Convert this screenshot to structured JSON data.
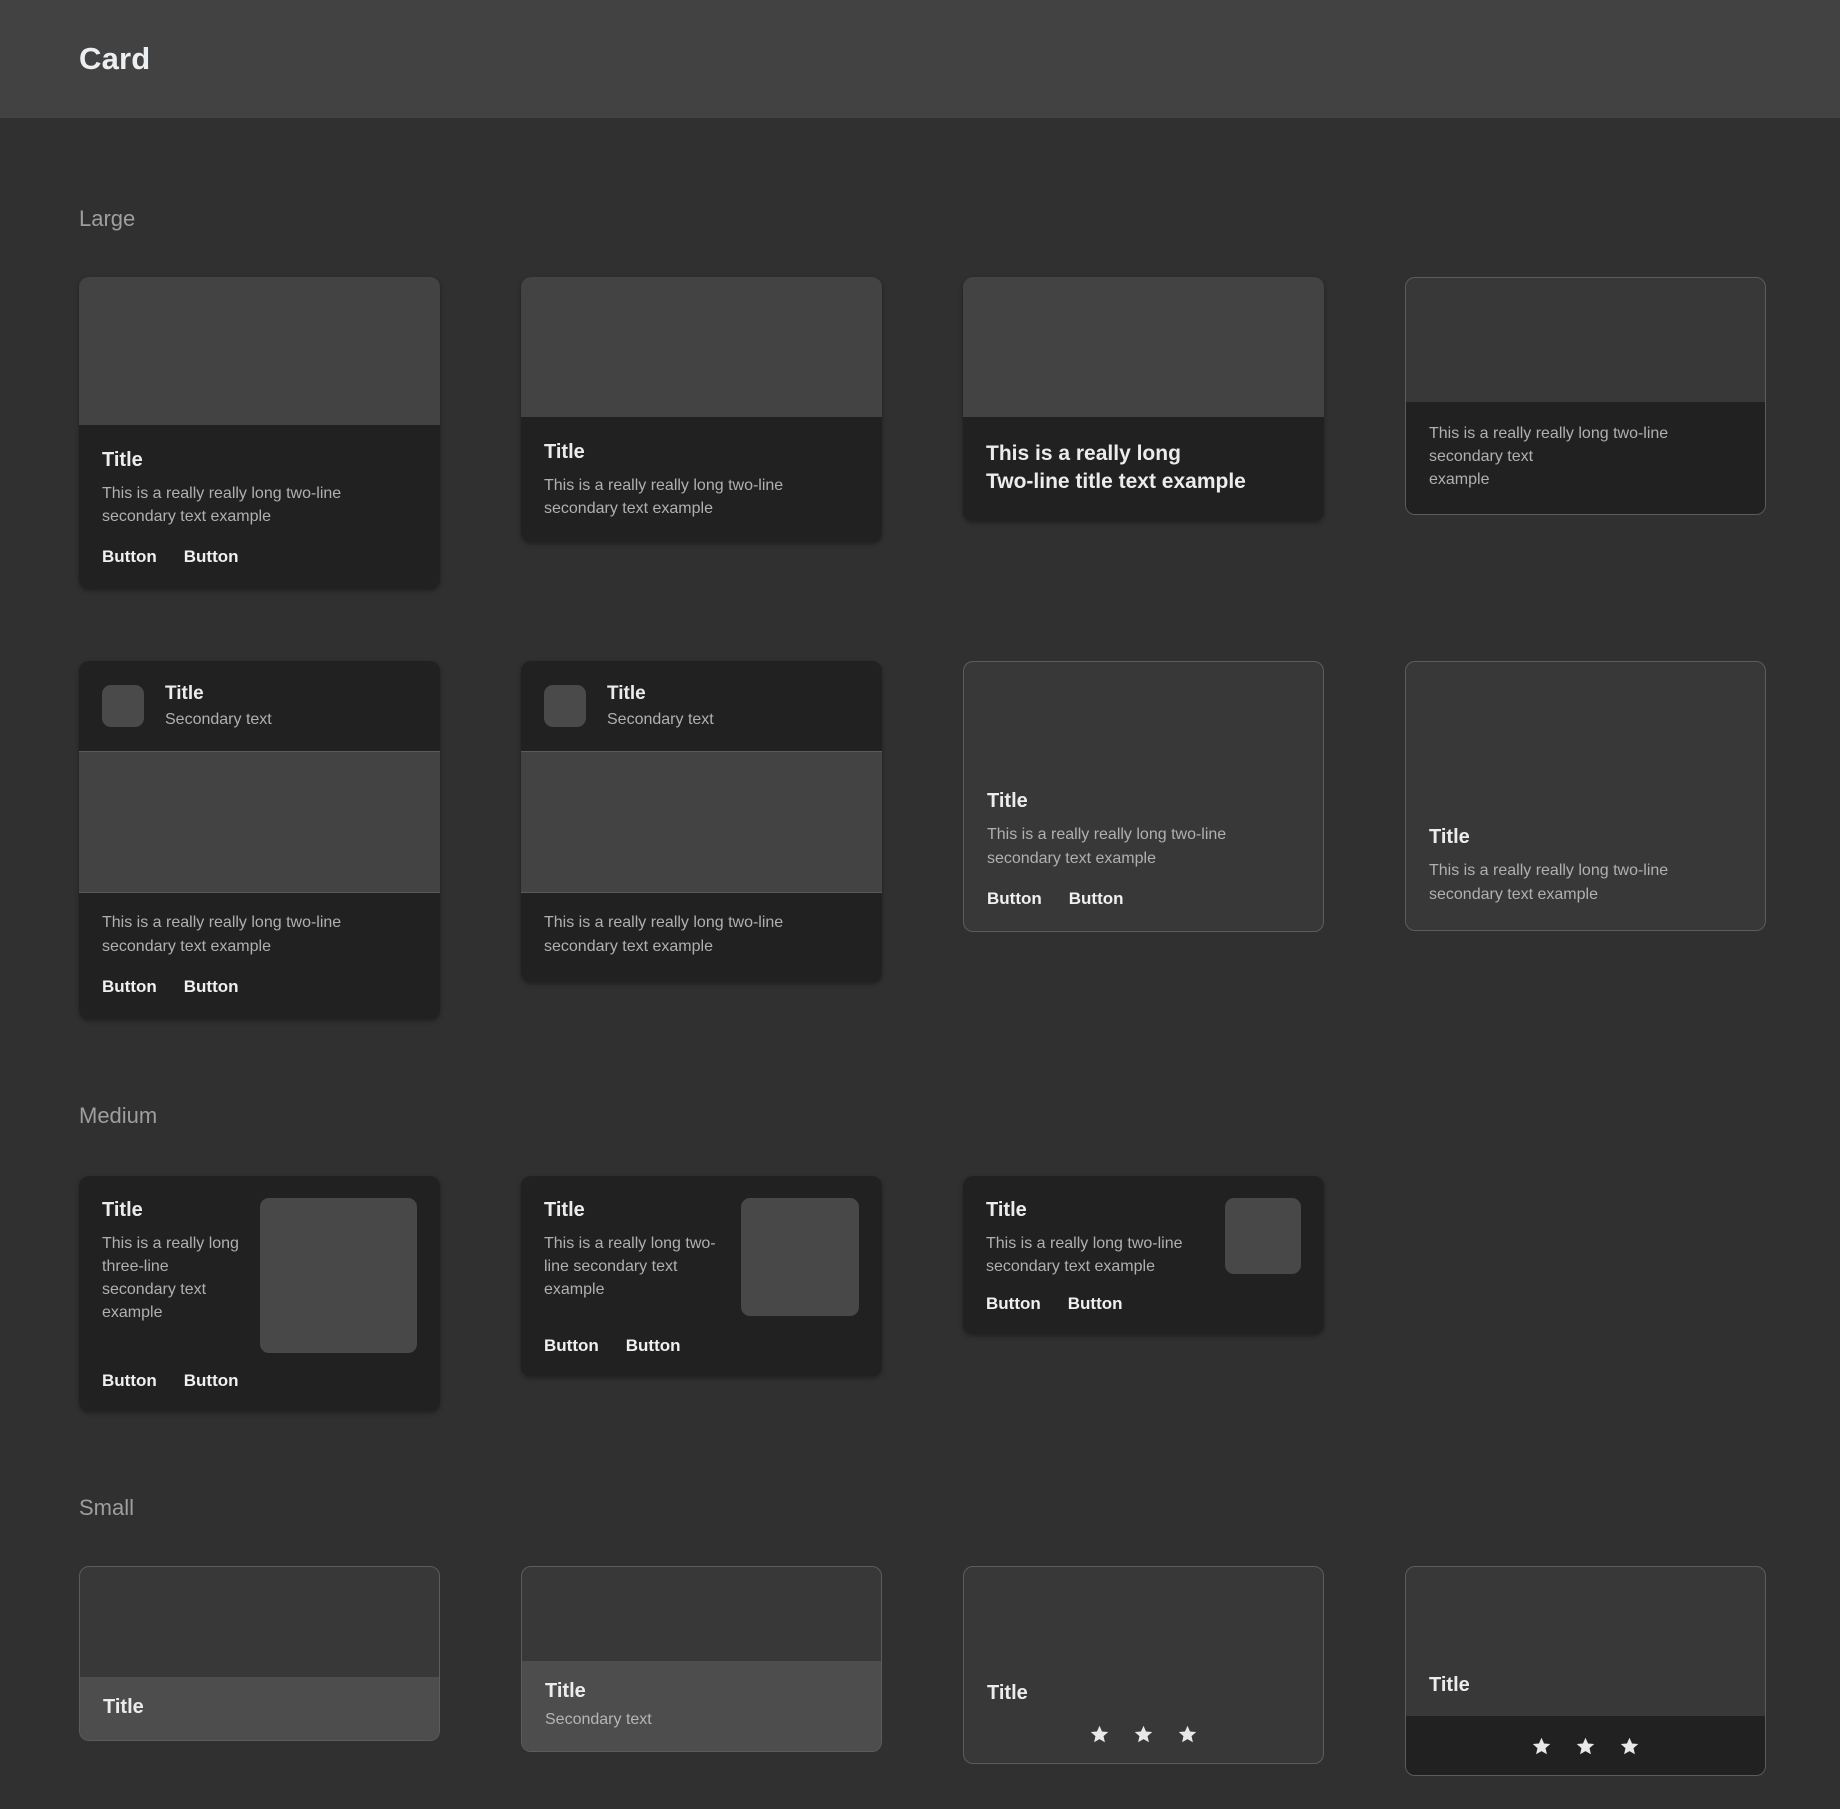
{
  "appbar": {
    "title": "Card"
  },
  "sections": {
    "large": "Large",
    "medium": "Medium",
    "small": "Small"
  },
  "text": {
    "title": "Title",
    "secondary_text": "Secondary text",
    "two_line_secondary": "This is a really really long two-line secondary text example",
    "two_line_secondary_wrapped": "This is a really really long two-line secondary text\nexample",
    "long_two_line_title": "This is a really long\nTwo-line title text example",
    "three_line_secondary": "This is a really long three-line secondary text example",
    "medium_two_line_secondary": "This is a really long two-line secondary text example",
    "button": "Button"
  },
  "icons": {
    "star": "star-icon",
    "avatar": "avatar-placeholder",
    "media": "media-placeholder"
  },
  "colors": {
    "background": "#303030",
    "appbar": "#424242",
    "card_elevated": "#212121",
    "card_filled": "#3b3b3b",
    "card_outlined_border": "#5c5c5c",
    "media": "#434343",
    "title": "#ececec",
    "secondary": "#b0b0b0",
    "section_label": "#9e9e9e",
    "footer_light": "#4d4d4d",
    "star": "#e8e8e8"
  },
  "cards": {
    "large": [
      {
        "name": "large-elevated-media-actions",
        "title": "Title",
        "secondary": "This is a really really long two-line secondary text example",
        "buttons": [
          "Button",
          "Button"
        ]
      },
      {
        "name": "large-elevated-media-no-actions",
        "title": "Title",
        "secondary": "This is a really really long two-line secondary text example"
      },
      {
        "name": "large-media-two-line-title",
        "title_line1": "This is a really long",
        "title_line2": "Two-line title text example"
      },
      {
        "name": "large-outlined-media-secondary-only",
        "secondary_line1": "This is a really really long two-line secondary text",
        "secondary_line2": "example"
      },
      {
        "name": "large-header-media-actions",
        "header_title": "Title",
        "header_secondary": "Secondary text",
        "secondary": "This is a really really long two-line secondary text example",
        "buttons": [
          "Button",
          "Button"
        ]
      },
      {
        "name": "large-header-media-no-actions",
        "header_title": "Title",
        "header_secondary": "Secondary text",
        "secondary": "This is a really really long two-line secondary text example"
      },
      {
        "name": "large-outlined-text-actions",
        "title": "Title",
        "secondary": "This is a really really long two-line secondary text example",
        "buttons": [
          "Button",
          "Button"
        ]
      },
      {
        "name": "large-outlined-text-only",
        "title": "Title",
        "secondary": "This is a really really long two-line secondary text example"
      }
    ],
    "medium": [
      {
        "name": "medium-thumb-three-line",
        "title": "Title",
        "secondary": "This is a really long three-line secondary text example",
        "buttons": [
          "Button",
          "Button"
        ]
      },
      {
        "name": "medium-thumb-two-line",
        "title": "Title",
        "secondary": "This is a really long two-line secondary text example",
        "buttons": [
          "Button",
          "Button"
        ]
      },
      {
        "name": "medium-thumb-compact",
        "title": "Title",
        "secondary": "This is a really long two-line secondary text example",
        "buttons": [
          "Button",
          "Button"
        ]
      }
    ],
    "small": [
      {
        "name": "small-media-title-footer",
        "title": "Title"
      },
      {
        "name": "small-media-title-secondary-footer",
        "title": "Title",
        "secondary": "Secondary text"
      },
      {
        "name": "small-outlined-title-stars",
        "title": "Title",
        "stars": 3
      },
      {
        "name": "small-title-dark-stars-footer",
        "title": "Title",
        "stars": 3
      }
    ]
  }
}
